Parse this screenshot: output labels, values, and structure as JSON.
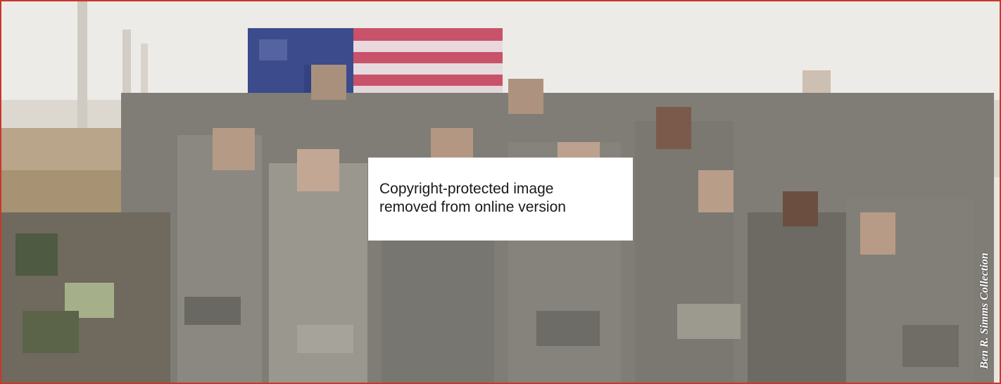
{
  "notice": {
    "line1": "Copyright-protected image",
    "line2": "removed from online version"
  },
  "credit": "Ben R. Simms Collection",
  "colors": {
    "frame_border": "#c8382a",
    "sky": "#e9e6e0",
    "uniform": "#7f7d76"
  },
  "photo": {
    "subject": "group of soldiers in camouflage uniforms in front of flag",
    "pixelated": true
  }
}
